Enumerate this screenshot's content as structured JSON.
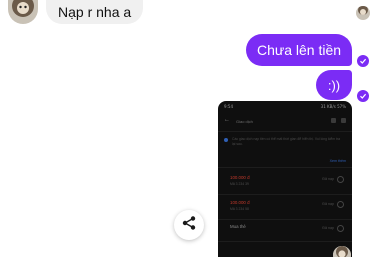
{
  "chat": {
    "incoming_message": "Nạp r nha a",
    "outgoing_message_1": "Chưa lên tiền",
    "outgoing_message_2": ":))"
  },
  "screenshot_attachment": {
    "status_bar_time": "9:54",
    "status_bar_right": "31 KB/s 57%",
    "title": "Giao dịch",
    "notice_text": "Các giao dịch nạp tiền có thể mất thời gian để hiển thị. Vui lòng kiểm tra lại sau.",
    "link_text": "Xem thêm",
    "transactions": [
      {
        "amount": "100.000 đ",
        "detail": "Mã 3 234 39",
        "status": "Đã nạp",
        "color": "#c0392b"
      },
      {
        "amount": "100.000 đ",
        "detail": "Mã 3 234 58",
        "status": "Đã nạp",
        "color": "#c0392b"
      },
      {
        "amount": "Mua thẻ",
        "detail": "",
        "status": "Đã nạp",
        "color": "#8a8a8a"
      }
    ]
  },
  "colors": {
    "outgoing_bubble": "#7b2cf5",
    "incoming_bubble": "#f0f0f0",
    "read_receipt": "#7b2cf5"
  },
  "icons": {
    "share": "share-icon",
    "read_receipt": "check-icon"
  }
}
